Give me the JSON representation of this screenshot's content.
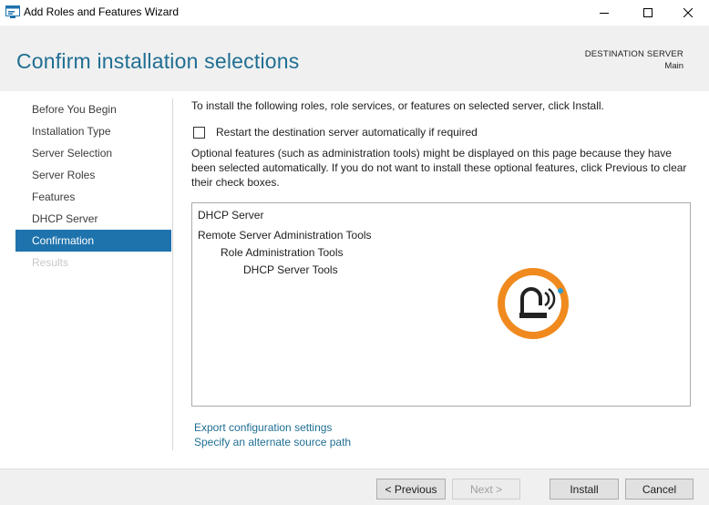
{
  "window": {
    "title": "Add Roles and Features Wizard",
    "icon": "server-manager-icon",
    "controls": [
      "minimize-icon",
      "maximize-icon",
      "close-icon"
    ]
  },
  "header": {
    "title": "Confirm installation selections",
    "destination_label": "DESTINATION SERVER",
    "destination_value": "Main"
  },
  "sidebar": {
    "items": [
      {
        "label": "Before You Begin",
        "state": "normal"
      },
      {
        "label": "Installation Type",
        "state": "normal"
      },
      {
        "label": "Server Selection",
        "state": "normal"
      },
      {
        "label": "Server Roles",
        "state": "normal"
      },
      {
        "label": "Features",
        "state": "normal"
      },
      {
        "label": "DHCP Server",
        "state": "normal"
      },
      {
        "label": "Confirmation",
        "state": "active"
      },
      {
        "label": "Results",
        "state": "disabled"
      }
    ]
  },
  "main": {
    "intro": "To install the following roles, role services, or features on selected server, click Install.",
    "restart_checkbox": {
      "label": "Restart the destination server automatically if required",
      "checked": false
    },
    "optional_note": "Optional features (such as administration tools) might be displayed on this page because they have been selected automatically. If you do not want to install these optional features, click Previous to clear their check boxes.",
    "selections": [
      {
        "label": "DHCP Server",
        "level": 0
      },
      {
        "label": "Remote Server Administration Tools",
        "level": 0
      },
      {
        "label": "Role Administration Tools",
        "level": 1
      },
      {
        "label": "DHCP Server Tools",
        "level": 2
      }
    ],
    "links": {
      "export": "Export configuration settings",
      "alternate_source": "Specify an alternate source path"
    }
  },
  "footer": {
    "previous": "< Previous",
    "next": "Next >",
    "install": "Install",
    "cancel": "Cancel"
  },
  "colors": {
    "accent": "#1e73ad",
    "title": "#1f6e93",
    "watermark_orange": "#f08a1e"
  }
}
